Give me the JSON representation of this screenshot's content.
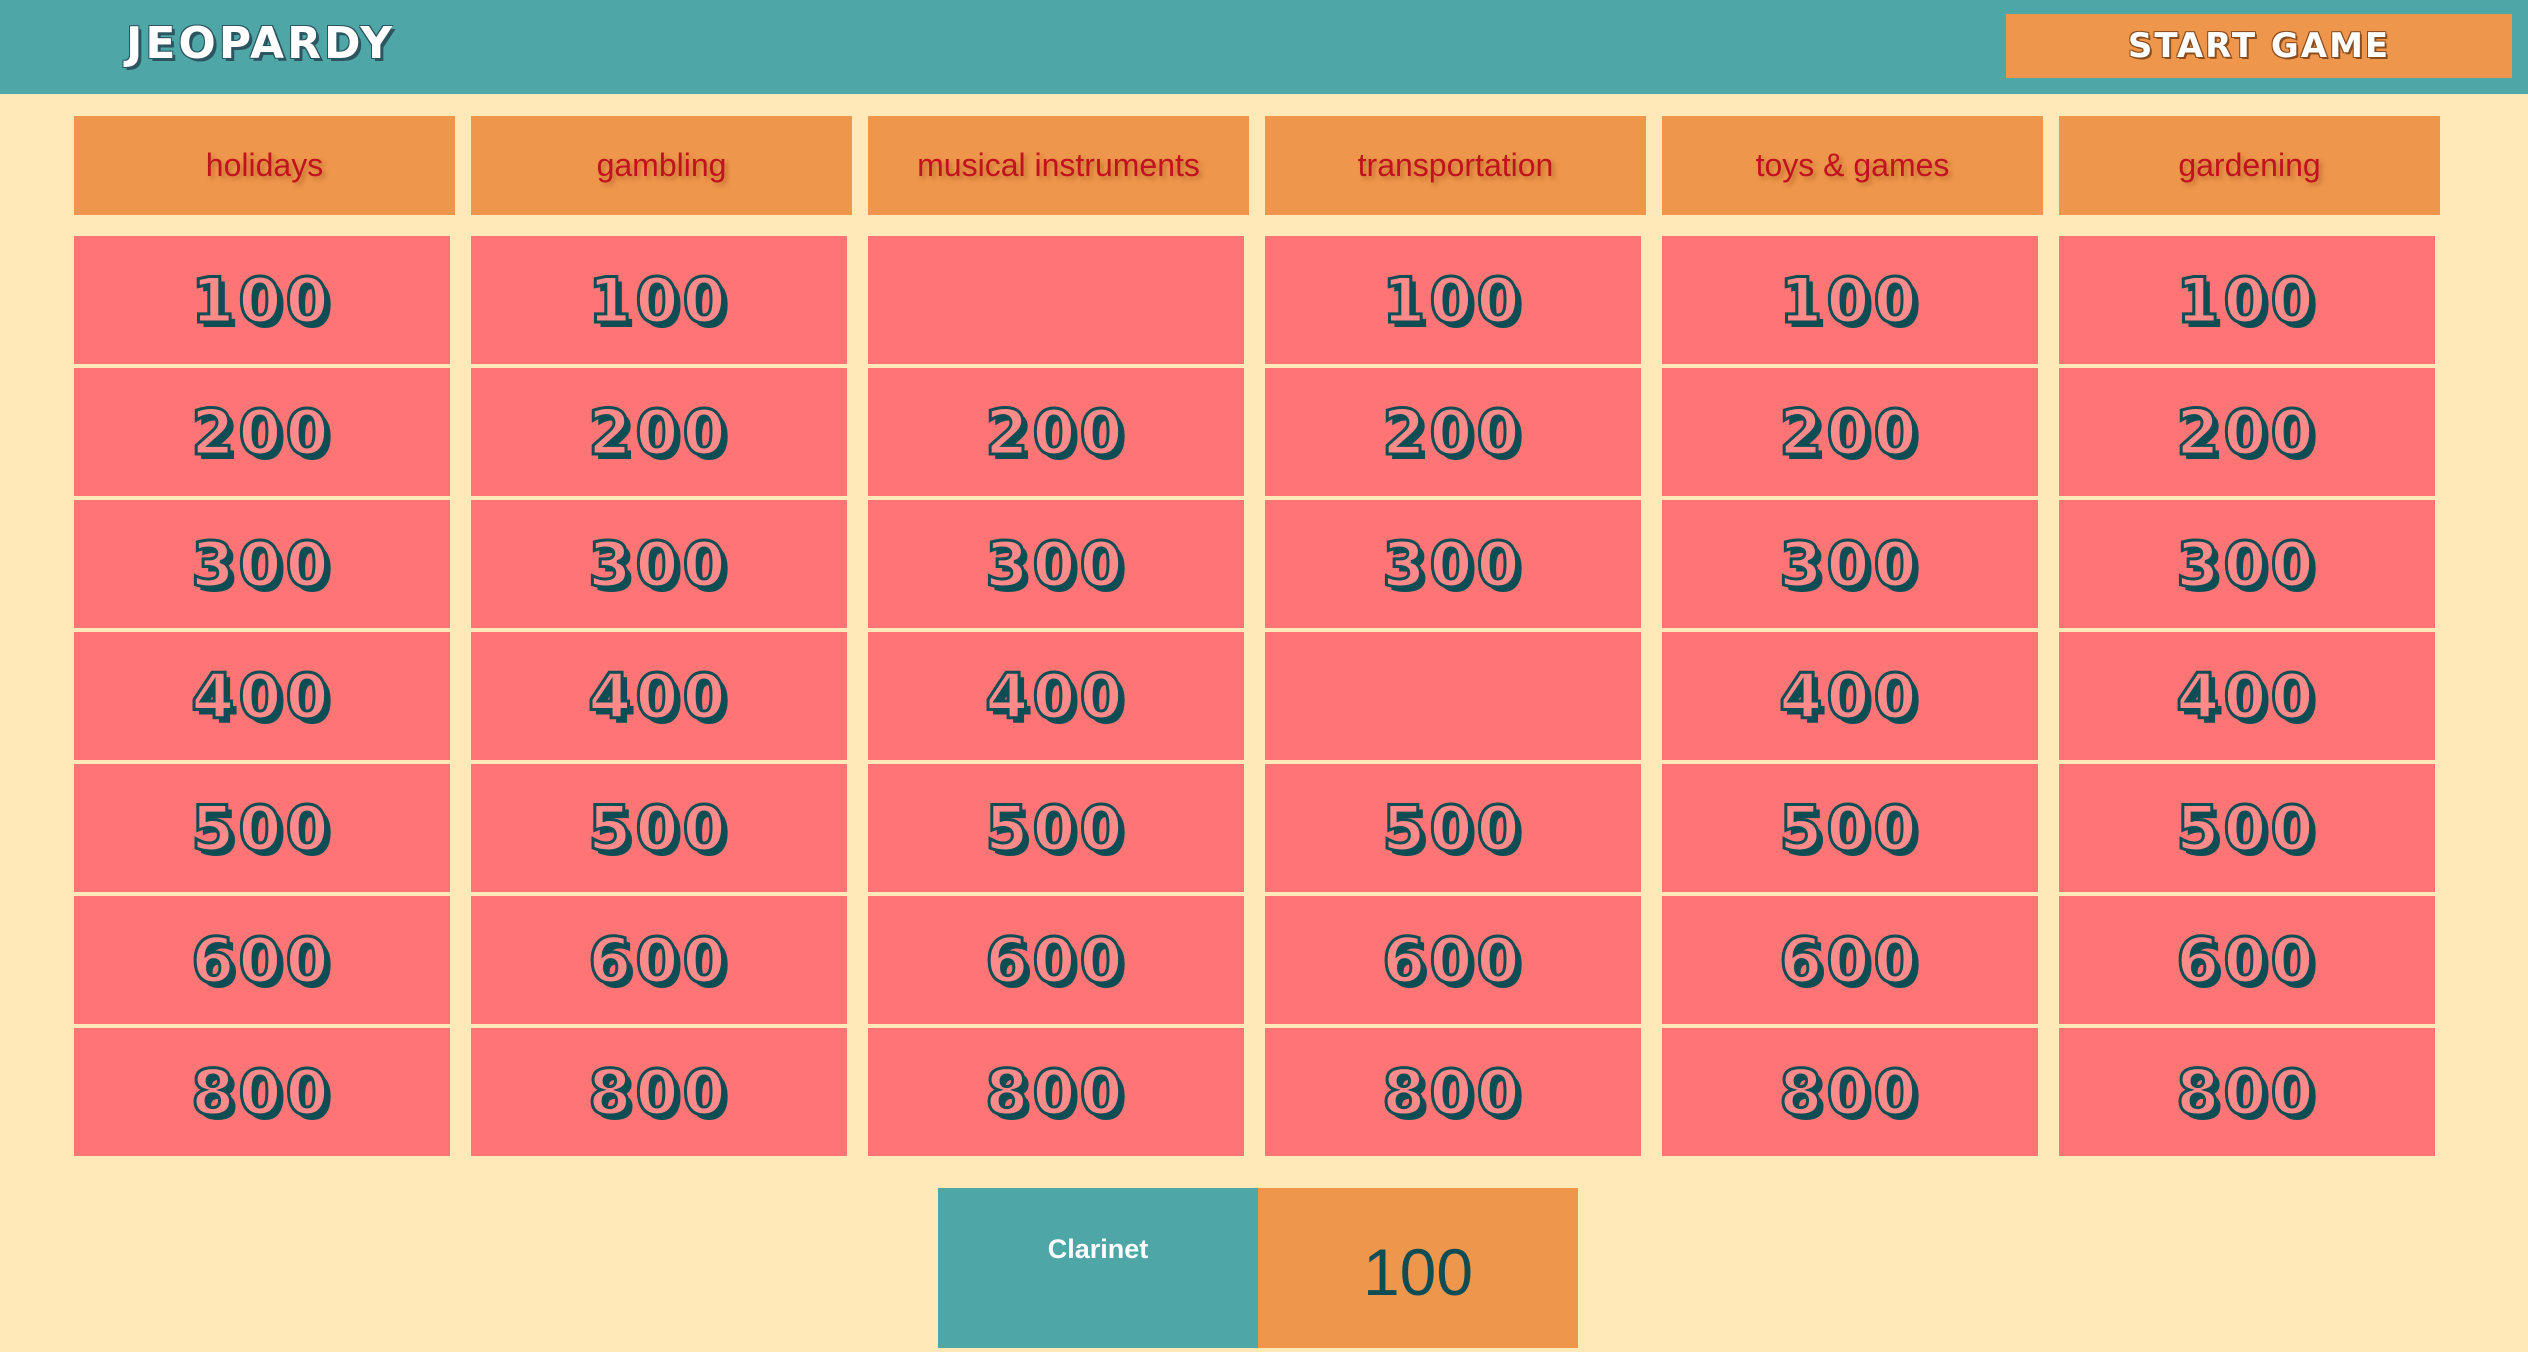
{
  "app": {
    "logo": "JEOPARDY",
    "start_button": "START GAME"
  },
  "categories": [
    "holidays",
    "gambling",
    "musical instruments",
    "transportation",
    "toys & games",
    "gardening"
  ],
  "board": [
    [
      "100",
      "100",
      "",
      "100",
      "100",
      "100"
    ],
    [
      "200",
      "200",
      "200",
      "200",
      "200",
      "200"
    ],
    [
      "300",
      "300",
      "300",
      "300",
      "300",
      "300"
    ],
    [
      "400",
      "400",
      "400",
      "",
      "400",
      "400"
    ],
    [
      "500",
      "500",
      "500",
      "500",
      "500",
      "500"
    ],
    [
      "600",
      "600",
      "600",
      "600",
      "600",
      "600"
    ],
    [
      "800",
      "800",
      "800",
      "800",
      "800",
      "800"
    ]
  ],
  "player": {
    "name": "Clarinet",
    "score": "100"
  },
  "colors": {
    "background": "#ffe9b8",
    "topbar": "#4fa6a7",
    "orange": "#ee964b",
    "cell": "#ff7575",
    "category_text": "#c1121f",
    "value_stroke": "#0f4d55"
  }
}
